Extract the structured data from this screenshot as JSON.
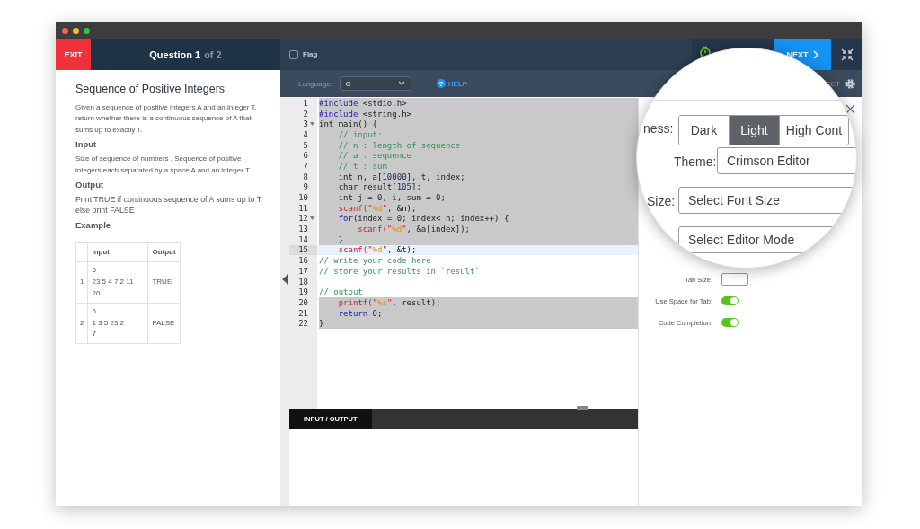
{
  "header": {
    "exit": "EXIT",
    "question": "Question 1",
    "question_total": "of 2",
    "flag": {
      "label": "Flag",
      "checked": false
    },
    "next": "NEXT"
  },
  "problem": {
    "title": "Sequence of Positive Integers",
    "sections": [
      {
        "kind": "text",
        "text": "Given a sequence of positive integers A and an integer T, return whether there is a continuous sequence of A that sums up to exactly T."
      },
      {
        "kind": "heading",
        "text": "Input"
      },
      {
        "kind": "text",
        "text": "Size of sequence of numbers , Sequence of positive integers each separated by a space A and an integer T"
      },
      {
        "kind": "heading",
        "text": "Output"
      },
      {
        "kind": "big",
        "text": "Print TRUE if continuous sequence of A sums up to T  else print FALSE"
      },
      {
        "kind": "heading",
        "text": "Example"
      }
    ],
    "table": {
      "columns": [
        "Input",
        "Output"
      ],
      "rows": [
        {
          "index": "1",
          "input": [
            "6",
            "23 5 4 7 2 11",
            "20"
          ],
          "output": "TRUE"
        },
        {
          "index": "2",
          "input": [
            "5",
            "1 3 5 23 2",
            "7"
          ],
          "output": "FALSE"
        }
      ]
    }
  },
  "toolbar": {
    "language_label": "Language:",
    "language": "C",
    "help_icon": "?",
    "help": "HELP",
    "reset": "SET"
  },
  "code": [
    {
      "number": "1",
      "fold": false,
      "selected": true,
      "current": false,
      "tokens": [
        {
          "kind": "keyword",
          "text": "#include"
        },
        {
          "kind": "plain",
          "text": " <stdio.h>"
        }
      ]
    },
    {
      "number": "2",
      "fold": false,
      "selected": true,
      "current": false,
      "tokens": [
        {
          "kind": "keyword",
          "text": "#include"
        },
        {
          "kind": "plain",
          "text": " <string.h>"
        }
      ]
    },
    {
      "number": "3",
      "fold": true,
      "selected": true,
      "current": false,
      "tokens": [
        {
          "kind": "plain",
          "text": "int main() {"
        }
      ]
    },
    {
      "number": "4",
      "fold": false,
      "selected": true,
      "current": false,
      "tokens": [
        {
          "kind": "comment",
          "text": "    // input:"
        }
      ]
    },
    {
      "number": "5",
      "fold": false,
      "selected": true,
      "current": false,
      "tokens": [
        {
          "kind": "comment",
          "text": "    // n : length of sequence"
        }
      ]
    },
    {
      "number": "6",
      "fold": false,
      "selected": true,
      "current": false,
      "tokens": [
        {
          "kind": "comment",
          "text": "    // a : sequence"
        }
      ]
    },
    {
      "number": "7",
      "fold": false,
      "selected": true,
      "current": false,
      "tokens": [
        {
          "kind": "comment",
          "text": "    // t : sum"
        }
      ]
    },
    {
      "number": "8",
      "fold": false,
      "selected": true,
      "current": false,
      "tokens": [
        {
          "kind": "plain",
          "text": "    int n, a["
        },
        {
          "kind": "number",
          "text": "10000"
        },
        {
          "kind": "plain",
          "text": "], t, index;"
        }
      ]
    },
    {
      "number": "9",
      "fold": false,
      "selected": true,
      "current": false,
      "tokens": [
        {
          "kind": "plain",
          "text": "    char result["
        },
        {
          "kind": "number",
          "text": "105"
        },
        {
          "kind": "plain",
          "text": "];"
        }
      ]
    },
    {
      "number": "10",
      "fold": false,
      "selected": true,
      "current": false,
      "tokens": [
        {
          "kind": "plain",
          "text": "    int j = "
        },
        {
          "kind": "number",
          "text": "0"
        },
        {
          "kind": "plain",
          "text": ", i, sum = "
        },
        {
          "kind": "number",
          "text": "0"
        },
        {
          "kind": "plain",
          "text": ";"
        }
      ]
    },
    {
      "number": "11",
      "fold": false,
      "selected": true,
      "current": false,
      "tokens": [
        {
          "kind": "call",
          "text": "    scanf(\""
        },
        {
          "kind": "format",
          "text": "%d"
        },
        {
          "kind": "call",
          "text": "\""
        },
        {
          "kind": "plain",
          "text": ", &n);"
        }
      ]
    },
    {
      "number": "12",
      "fold": true,
      "selected": true,
      "current": false,
      "tokens": [
        {
          "kind": "keyword",
          "text": "    for"
        },
        {
          "kind": "plain",
          "text": "(index = "
        },
        {
          "kind": "number",
          "text": "0"
        },
        {
          "kind": "plain",
          "text": "; index< n; index++) {"
        }
      ]
    },
    {
      "number": "13",
      "fold": false,
      "selected": true,
      "current": false,
      "tokens": [
        {
          "kind": "call",
          "text": "        scanf(\""
        },
        {
          "kind": "format",
          "text": "%d"
        },
        {
          "kind": "call",
          "text": "\""
        },
        {
          "kind": "plain",
          "text": ", &a[index]);"
        }
      ]
    },
    {
      "number": "14",
      "fold": false,
      "selected": true,
      "current": false,
      "tokens": [
        {
          "kind": "plain",
          "text": "    }"
        }
      ]
    },
    {
      "number": "15",
      "fold": false,
      "selected": false,
      "current": true,
      "tokens": [
        {
          "kind": "call",
          "text": "    scanf(\""
        },
        {
          "kind": "format",
          "text": "%d"
        },
        {
          "kind": "call",
          "text": "\""
        },
        {
          "kind": "plain",
          "text": ", &t);"
        }
      ]
    },
    {
      "number": "16",
      "fold": false,
      "selected": false,
      "current": false,
      "tokens": [
        {
          "kind": "comment",
          "text": "// write your code here"
        }
      ]
    },
    {
      "number": "17",
      "fold": false,
      "selected": false,
      "current": false,
      "tokens": [
        {
          "kind": "comment",
          "text": "// store your results in `result`"
        }
      ]
    },
    {
      "number": "18",
      "fold": false,
      "selected": false,
      "current": false
    },
    {
      "number": "19",
      "fold": false,
      "selected": false,
      "current": false,
      "tokens": [
        {
          "kind": "comment",
          "text": "// output"
        }
      ]
    },
    {
      "number": "20",
      "fold": false,
      "selected": true,
      "current": false,
      "tokens": [
        {
          "kind": "call",
          "text": "    printf(\""
        },
        {
          "kind": "format",
          "text": "%s"
        },
        {
          "kind": "call",
          "text": "\""
        },
        {
          "kind": "plain",
          "text": ", result);"
        }
      ]
    },
    {
      "number": "21",
      "fold": false,
      "selected": true,
      "current": false,
      "tokens": [
        {
          "kind": "keyword",
          "text": "    return "
        },
        {
          "kind": "number",
          "text": "0"
        },
        {
          "kind": "plain",
          "text": ";"
        }
      ]
    },
    {
      "number": "22",
      "fold": false,
      "selected": true,
      "current": false,
      "tokens": [
        {
          "kind": "plain",
          "text": "}"
        }
      ]
    }
  ],
  "io_tab": "INPUT / OUTPUT",
  "settings": {
    "tab_size_label": "Tab Size:",
    "toggles": [
      {
        "label": "Use Space for Tab:",
        "on": true
      },
      {
        "label": "Code Completion:",
        "on": true
      }
    ]
  },
  "magnifier": {
    "brightness_label": "ness:",
    "brightness_options": [
      {
        "label": "Dark",
        "selected": false
      },
      {
        "label": "Light",
        "selected": true
      },
      {
        "label": "High Cont",
        "selected": false
      }
    ],
    "theme_label": "Theme:",
    "theme": "Crimson Editor",
    "size_label": "Size:",
    "font_size_placeholder": "Select Font Size",
    "editor_mode_placeholder": "Select Editor Mode"
  }
}
